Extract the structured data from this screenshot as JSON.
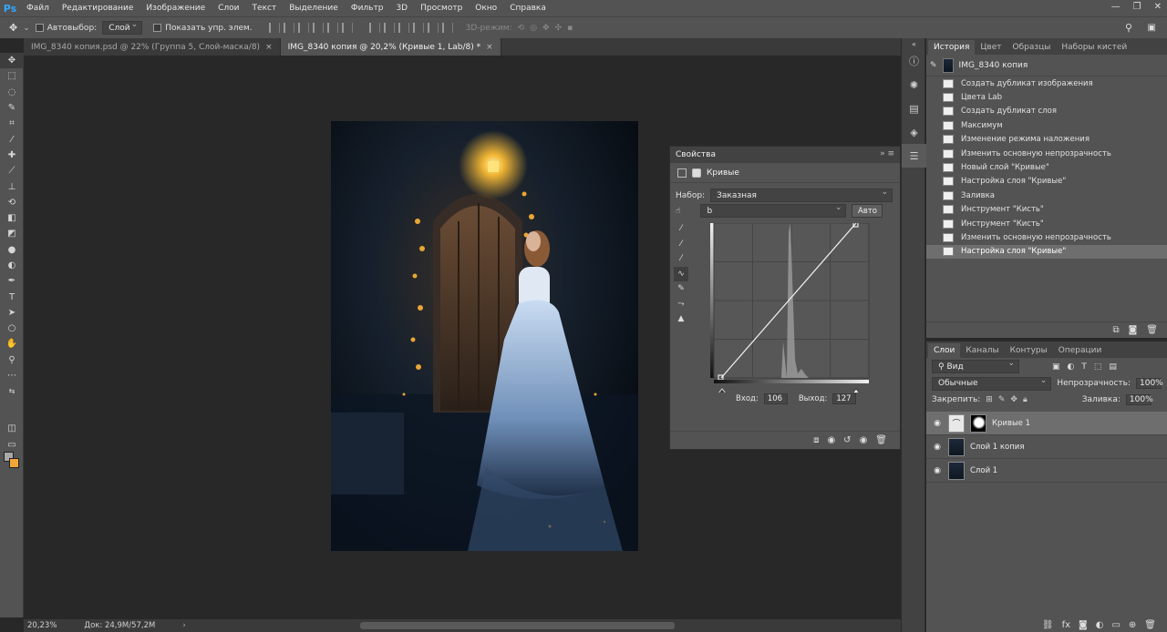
{
  "app": {
    "logo": "Ps",
    "window_controls": [
      "—",
      "❐",
      "✕"
    ]
  },
  "menu": [
    "Файл",
    "Редактирование",
    "Изображение",
    "Слои",
    "Текст",
    "Выделение",
    "Фильтр",
    "3D",
    "Просмотр",
    "Окно",
    "Справка"
  ],
  "options_bar": {
    "autoselect_label": "Автовыбор:",
    "autoselect_value": "Слой",
    "show_controls_label": "Показать упр. элем.",
    "mode_3d_label": "3D-режим:"
  },
  "tabs": [
    {
      "label": "IMG_8340 копия.psd @ 22% (Группа 5, Слой-маска/8)"
    },
    {
      "label": "IMG_8340 копия @ 20,2% (Кривые 1, Lab/8) *"
    }
  ],
  "status": {
    "zoom": "20,23%",
    "doc": "Док: 24,9M/57,2M"
  },
  "properties": {
    "panel_title": "Свойства",
    "adjustment_title": "Кривые",
    "preset_label": "Набор:",
    "preset_value": "Заказная",
    "channel_value": "b",
    "auto_label": "Авто",
    "input_label": "Вход:",
    "input_value": "106",
    "output_label": "Выход:",
    "output_value": "127",
    "curve_point": {
      "input": 106,
      "output": 127
    }
  },
  "history": {
    "tabs": [
      "История",
      "Цвет",
      "Образцы",
      "Наборы кистей"
    ],
    "snapshot": "IMG_8340 копия",
    "items": [
      "Создать дубликат изображения",
      "Цвета Lab",
      "Создать дубликат слоя",
      "Максимум",
      "Изменение режима наложения",
      "Изменить основную непрозрачность",
      "Новый слой \"Кривые\"",
      "Настройка слоя \"Кривые\"",
      "Заливка",
      "Инструмент \"Кисть\"",
      "Инструмент \"Кисть\"",
      "Изменить основную непрозрачность",
      "Настройка слоя \"Кривые\""
    ],
    "selected_index": 12
  },
  "layers": {
    "tabs": [
      "Слои",
      "Каналы",
      "Контуры",
      "Операции"
    ],
    "filter_value": "Вид",
    "blend_mode": "Обычные",
    "opacity_label": "Непрозрачность:",
    "opacity_value": "100%",
    "lock_label": "Закрепить:",
    "fill_label": "Заливка:",
    "fill_value": "100%",
    "items": [
      {
        "name": "Кривые 1"
      },
      {
        "name": "Слой 1 копия"
      },
      {
        "name": "Слой 1"
      }
    ]
  }
}
